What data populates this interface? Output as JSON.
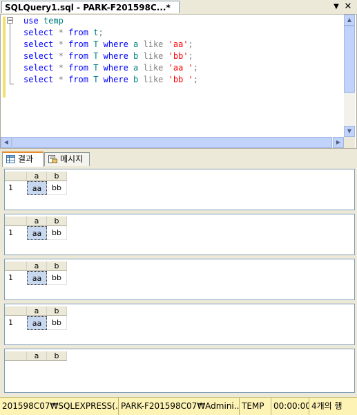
{
  "document_tab": {
    "title": "SQLQuery1.sql - PARK-F201598C...*",
    "dropdown_icon": "triangle-down-icon",
    "close_icon": "close-icon"
  },
  "editor": {
    "lines": [
      [
        {
          "t": "use",
          "c": "kw"
        },
        {
          "t": " "
        },
        {
          "t": "temp",
          "c": "tx"
        }
      ],
      [
        {
          "t": "select",
          "c": "kw"
        },
        {
          "t": " "
        },
        {
          "t": "*",
          "c": "gr"
        },
        {
          "t": " "
        },
        {
          "t": "from",
          "c": "kw"
        },
        {
          "t": " "
        },
        {
          "t": "t",
          "c": "tx"
        },
        {
          "t": ";",
          "c": "gr"
        }
      ],
      [
        {
          "t": "select",
          "c": "kw"
        },
        {
          "t": " "
        },
        {
          "t": "*",
          "c": "gr"
        },
        {
          "t": " "
        },
        {
          "t": "from",
          "c": "kw"
        },
        {
          "t": " "
        },
        {
          "t": "T",
          "c": "tx"
        },
        {
          "t": " "
        },
        {
          "t": "where",
          "c": "kw"
        },
        {
          "t": " "
        },
        {
          "t": "a",
          "c": "tx"
        },
        {
          "t": " "
        },
        {
          "t": "like",
          "c": "gr"
        },
        {
          "t": " "
        },
        {
          "t": "'aa'",
          "c": "st"
        },
        {
          "t": ";",
          "c": "gr"
        }
      ],
      [
        {
          "t": "select",
          "c": "kw"
        },
        {
          "t": " "
        },
        {
          "t": "*",
          "c": "gr"
        },
        {
          "t": " "
        },
        {
          "t": "from",
          "c": "kw"
        },
        {
          "t": " "
        },
        {
          "t": "T",
          "c": "tx"
        },
        {
          "t": " "
        },
        {
          "t": "where",
          "c": "kw"
        },
        {
          "t": " "
        },
        {
          "t": "b",
          "c": "tx"
        },
        {
          "t": " "
        },
        {
          "t": "like",
          "c": "gr"
        },
        {
          "t": " "
        },
        {
          "t": "'bb'",
          "c": "st"
        },
        {
          "t": ";",
          "c": "gr"
        }
      ],
      [
        {
          "t": "select",
          "c": "kw"
        },
        {
          "t": " "
        },
        {
          "t": "*",
          "c": "gr"
        },
        {
          "t": " "
        },
        {
          "t": "from",
          "c": "kw"
        },
        {
          "t": " "
        },
        {
          "t": "T",
          "c": "tx"
        },
        {
          "t": " "
        },
        {
          "t": "where",
          "c": "kw"
        },
        {
          "t": " "
        },
        {
          "t": "a",
          "c": "tx"
        },
        {
          "t": " "
        },
        {
          "t": "like",
          "c": "gr"
        },
        {
          "t": " "
        },
        {
          "t": "'aa '",
          "c": "st"
        },
        {
          "t": ";",
          "c": "gr"
        }
      ],
      [
        {
          "t": "select",
          "c": "kw"
        },
        {
          "t": " "
        },
        {
          "t": "*",
          "c": "gr"
        },
        {
          "t": " "
        },
        {
          "t": "from",
          "c": "kw"
        },
        {
          "t": " "
        },
        {
          "t": "T",
          "c": "tx"
        },
        {
          "t": " "
        },
        {
          "t": "where",
          "c": "kw"
        },
        {
          "t": " "
        },
        {
          "t": "b",
          "c": "tx"
        },
        {
          "t": " "
        },
        {
          "t": "like",
          "c": "gr"
        },
        {
          "t": " "
        },
        {
          "t": "'bb '",
          "c": "st"
        },
        {
          "t": ";",
          "c": "gr"
        }
      ]
    ],
    "colors": {
      "keyword": "#0000ff",
      "operator": "#808080",
      "identifier": "#008080",
      "string": "#ff0000"
    }
  },
  "result_tabs": [
    {
      "label": "결과",
      "icon": "grid-icon"
    },
    {
      "label": "메시지",
      "icon": "messages-icon"
    }
  ],
  "result_grids": [
    {
      "columns": [
        "a",
        "b"
      ],
      "rows": [
        {
          "num": "1",
          "cells": [
            "aa",
            "bb"
          ]
        }
      ]
    },
    {
      "columns": [
        "a",
        "b"
      ],
      "rows": [
        {
          "num": "1",
          "cells": [
            "aa",
            "bb"
          ]
        }
      ]
    },
    {
      "columns": [
        "a",
        "b"
      ],
      "rows": [
        {
          "num": "1",
          "cells": [
            "aa",
            "bb"
          ]
        }
      ]
    },
    {
      "columns": [
        "a",
        "b"
      ],
      "rows": [
        {
          "num": "1",
          "cells": [
            "aa",
            "bb"
          ]
        }
      ]
    },
    {
      "columns": [
        "a",
        "b"
      ],
      "rows": []
    }
  ],
  "status_bar": {
    "server": "201598C07₩SQLEXPRESS(...",
    "user": "PARK-F201598C07₩Admini...",
    "database": "TEMP",
    "elapsed": "00:00:00",
    "rows": "4개의 행"
  }
}
